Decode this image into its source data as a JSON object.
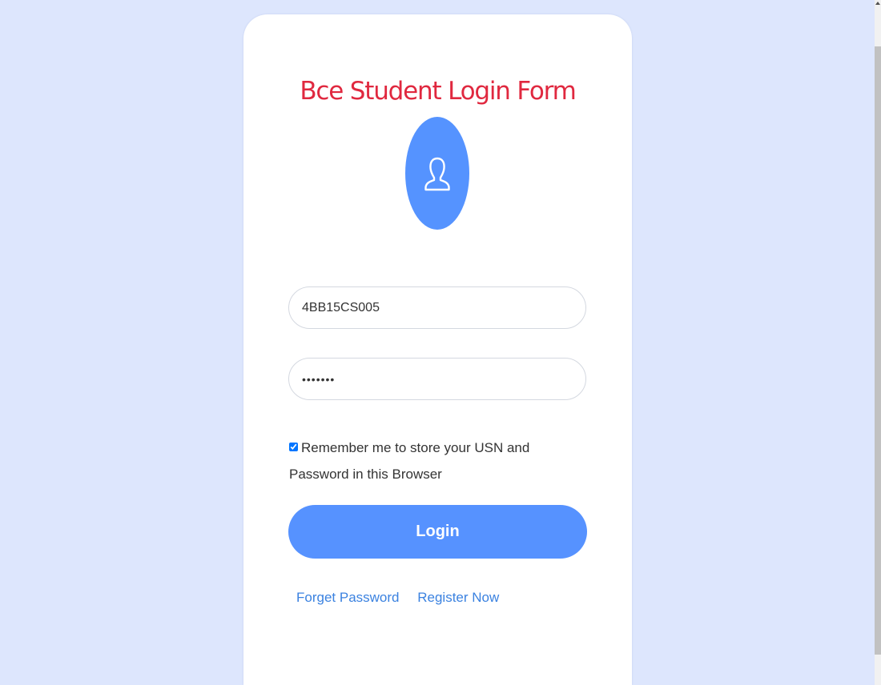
{
  "form": {
    "title": "Bce Student Login Form",
    "usn_value": "4BB15CS005",
    "password_value": "1234567",
    "remember_label": "Remember me to store your USN and Password in this Browser",
    "remember_checked": true,
    "login_label": "Login",
    "forgot_label": "Forget Password",
    "register_label": "Register Now"
  },
  "icons": {
    "avatar": "user-icon"
  },
  "colors": {
    "background": "#dde6fd",
    "title": "#e0283f",
    "accent": "#5692ff",
    "link": "#3b82e0"
  }
}
